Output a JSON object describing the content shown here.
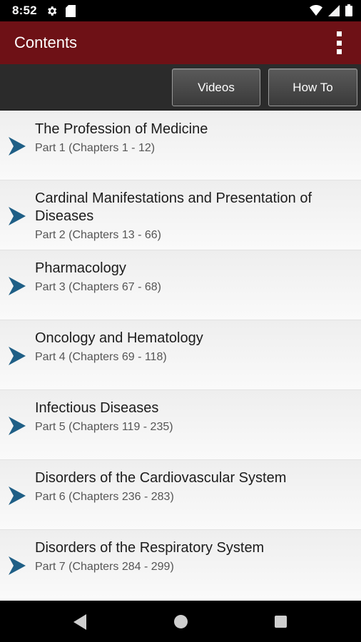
{
  "status": {
    "time": "8:52",
    "icons": [
      "gear-icon",
      "sd-card-icon",
      "wifi-icon",
      "signal-icon",
      "battery-icon"
    ]
  },
  "app_bar": {
    "title": "Contents",
    "menu_icon": "overflow-menu-icon",
    "background_color": "#6e1116"
  },
  "toolbar": {
    "videos_label": "Videos",
    "howto_label": "How To"
  },
  "contents": [
    {
      "title": "The Profession of Medicine",
      "subtitle": "Part 1 (Chapters 1 - 12)"
    },
    {
      "title": "Cardinal Manifestations and Presentation of Diseases",
      "subtitle": "Part 2 (Chapters 13 - 66)"
    },
    {
      "title": "Pharmacology",
      "subtitle": "Part 3 (Chapters 67 - 68)"
    },
    {
      "title": "Oncology and Hematology",
      "subtitle": "Part 4 (Chapters 69 - 118)"
    },
    {
      "title": "Infectious Diseases",
      "subtitle": "Part 5 (Chapters 119 - 235)"
    },
    {
      "title": "Disorders of the Cardiovascular System",
      "subtitle": "Part 6 (Chapters 236 - 283)"
    },
    {
      "title": "Disorders of the Respiratory System",
      "subtitle": "Part 7 (Chapters 284 - 299)"
    }
  ],
  "colors": {
    "chevron": "#1f5f86",
    "nav_icon": "#cfcfcf"
  },
  "nav": {
    "icons": [
      "back-icon",
      "home-icon",
      "recent-apps-icon"
    ]
  }
}
